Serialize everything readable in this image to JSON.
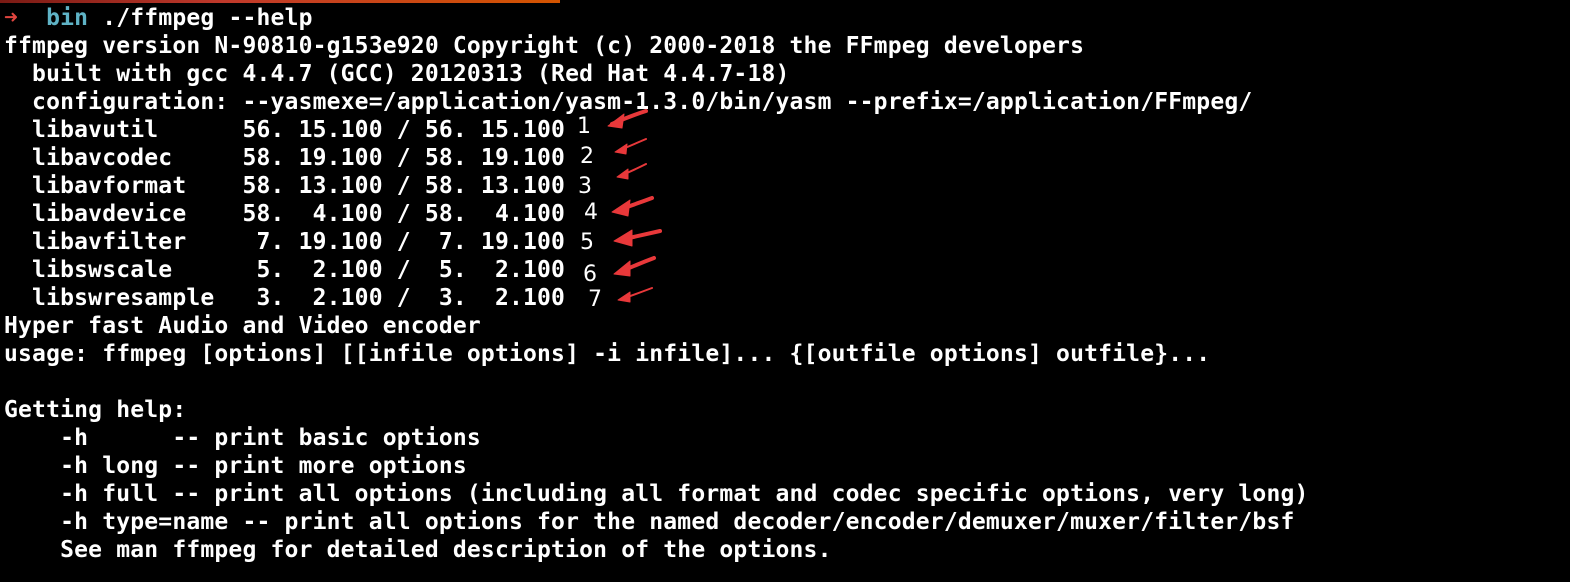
{
  "prompt": {
    "arrow": "➜",
    "directory": "bin",
    "command": "./ffmpeg --help",
    "arrow_color": "#e0453f",
    "directory_color": "#5fb3c6"
  },
  "output_lines": [
    "ffmpeg version N-90810-g153e920 Copyright (c) 2000-2018 the FFmpeg developers",
    "  built with gcc 4.4.7 (GCC) 20120313 (Red Hat 4.4.7-18)",
    "  configuration: --yasmexe=/application/yasm-1.3.0/bin/yasm --prefix=/application/FFmpeg/",
    "  libavutil      56. 15.100 / 56. 15.100",
    "  libavcodec     58. 19.100 / 58. 19.100",
    "  libavformat    58. 13.100 / 58. 13.100",
    "  libavdevice    58.  4.100 / 58.  4.100",
    "  libavfilter     7. 19.100 /  7. 19.100",
    "  libswscale      5.  2.100 /  5.  2.100",
    "  libswresample   3.  2.100 /  3.  2.100",
    "Hyper fast Audio and Video encoder",
    "usage: ffmpeg [options] [[infile options] -i infile]... {[outfile options] outfile}...",
    "",
    "Getting help:",
    "    -h      -- print basic options",
    "    -h long -- print more options",
    "    -h full -- print all options (including all format and codec specific options, very long)",
    "    -h type=name -- print all options for the named decoder/encoder/demuxer/muxer/filter/bsf",
    "    See man ffmpeg for detailed description of the options."
  ],
  "annotations": {
    "numbers": [
      "1",
      "2",
      "3",
      "4",
      "5",
      "6",
      "7"
    ],
    "arrow_color": "#e8383a"
  },
  "colors": {
    "background": "#000000",
    "text": "#ffffff",
    "top_strip": "#c0392b"
  }
}
